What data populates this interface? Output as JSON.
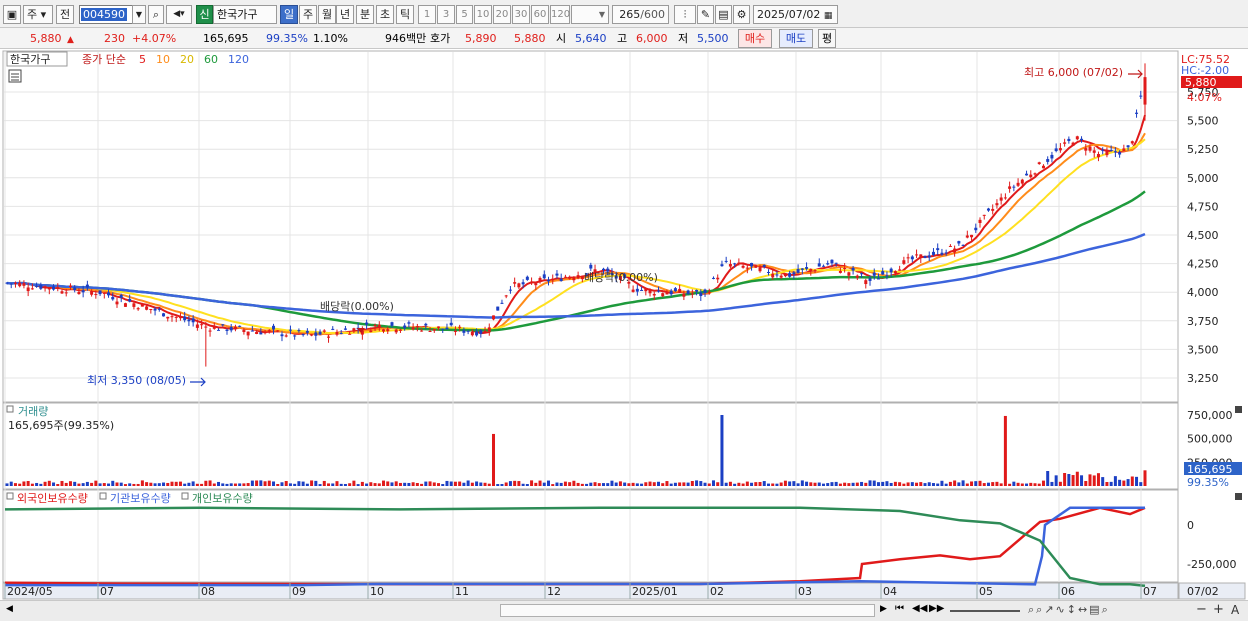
{
  "toolbar": {
    "period_type": "주",
    "prev_label": "전",
    "stock_code": "004590",
    "new_badge": "신",
    "stock_name": "한국가구",
    "intervals": [
      "일",
      "주",
      "월",
      "년",
      "분",
      "초",
      "틱"
    ],
    "selected_interval": "일",
    "minute_steps": [
      "1",
      "3",
      "5",
      "10",
      "20",
      "30",
      "60",
      "120"
    ],
    "count_display": "265",
    "count_total": "/600",
    "date": "2025/07/02"
  },
  "quote": {
    "price": "5,880",
    "change": "230",
    "change_pct": "+4.07%",
    "volume": "165,695",
    "volume_ratio": "99.35%",
    "turnover": "1.10%",
    "amount": "946백만",
    "bid_label": "호가",
    "bid1": "5,890",
    "bid2": "5,880",
    "open_label": "시",
    "open": "5,640",
    "high_label": "고",
    "high": "6,000",
    "low_label": "저",
    "low": "5,500",
    "buy_label": "매수",
    "sell_label": "매도",
    "eval_label": "평"
  },
  "price_panel": {
    "stock_tag": "한국가구",
    "ma_title": "종가 단순",
    "ma_periods": [
      "5",
      "10",
      "20",
      "60",
      "120"
    ],
    "ma_colors": [
      "#e01a1a",
      "#ff8c1a",
      "#ffe020",
      "#1e9a3c",
      "#3c64dc"
    ],
    "lc_label": "LC:75.52",
    "hc_label": "HC:-2.00",
    "current_price_badge": "5,880",
    "current_pct": "4.07%",
    "high_annotation": "최고 6,000 (07/02)",
    "low_annotation": "최저 3,350 (08/05)",
    "dividend_label_1": "배당락(0.00%)",
    "dividend_label_2": "배당락(0.00%)",
    "y_ticks": [
      "5,750",
      "5,500",
      "5,250",
      "5,000",
      "4,750",
      "4,500",
      "4,250",
      "4,000",
      "3,750",
      "3,500",
      "3,250"
    ]
  },
  "volume_panel": {
    "title": "거래량",
    "summary": "165,695주(99.35%)",
    "y_ticks": [
      "750,000",
      "500,000",
      "250,000"
    ],
    "current_badge": "165,695",
    "current_pct": "99.35%"
  },
  "holdings_panel": {
    "legend": [
      "외국인보유수량",
      "기관보유수량",
      "개인보유수량"
    ],
    "legend_colors": [
      "#e01a1a",
      "#3c64dc",
      "#2e8b57"
    ],
    "y_ticks": [
      "0",
      "-250,000"
    ]
  },
  "x_axis": {
    "labels": [
      "2024/05",
      "07",
      "08",
      "09",
      "10",
      "11",
      "12",
      "2025/01",
      "02",
      "03",
      "04",
      "05",
      "06",
      "07"
    ],
    "end_label": "07/02"
  },
  "chart_data": {
    "type": "candlestick",
    "ylim": [
      3250,
      6000
    ],
    "month_labels": [
      "2024/05",
      "07",
      "08",
      "09",
      "10",
      "11",
      "12",
      "2025/01",
      "02",
      "03",
      "04",
      "05",
      "06",
      "07"
    ],
    "close_keypoints": [
      {
        "date": "2024/06",
        "value": 4080
      },
      {
        "date": "2024/07",
        "value": 4000
      },
      {
        "date": "2024/08",
        "value": 3700
      },
      {
        "date": "2024/09",
        "value": 3620
      },
      {
        "date": "2024/10",
        "value": 3710
      },
      {
        "date": "2024/11",
        "value": 3680
      },
      {
        "date": "2024/11",
        "value": 3650
      },
      {
        "date": "2024/11",
        "value": 4050
      },
      {
        "date": "2024/12",
        "value": 4100
      },
      {
        "date": "2024/12",
        "value": 4200
      },
      {
        "date": "2025/01",
        "value": 4020
      },
      {
        "date": "2025/02",
        "value": 3980
      },
      {
        "date": "2025/02",
        "value": 4250
      },
      {
        "date": "2025/03",
        "value": 4150
      },
      {
        "date": "2025/03",
        "value": 4250
      },
      {
        "date": "2025/04",
        "value": 4100
      },
      {
        "date": "2025/04",
        "value": 4280
      },
      {
        "date": "2025/05",
        "value": 4400
      },
      {
        "date": "2025/05",
        "value": 4900
      },
      {
        "date": "2025/06",
        "value": 5350
      },
      {
        "date": "2025/06",
        "value": 5200
      },
      {
        "date": "2025/07",
        "value": 5250
      },
      {
        "date": "2025/07/02",
        "value": 5880
      }
    ],
    "high": {
      "value": 6000,
      "date": "07/02"
    },
    "low": {
      "value": 3350,
      "date": "08/05"
    },
    "last": {
      "open": 5640,
      "high": 6000,
      "low": 5500,
      "close": 5880,
      "volume": 165695
    },
    "volume_ylim": [
      0,
      750000
    ],
    "volume_spikes": [
      550000,
      750000,
      740000
    ],
    "holdings_ylim": [
      -400000,
      150000
    ],
    "series": [
      {
        "name": "외국인보유수량",
        "start": -370000,
        "end": 110000
      },
      {
        "name": "기관보유수량",
        "start": -385000,
        "end": 110000
      },
      {
        "name": "개인보유수량",
        "start": 100000,
        "end": -390000
      }
    ]
  }
}
